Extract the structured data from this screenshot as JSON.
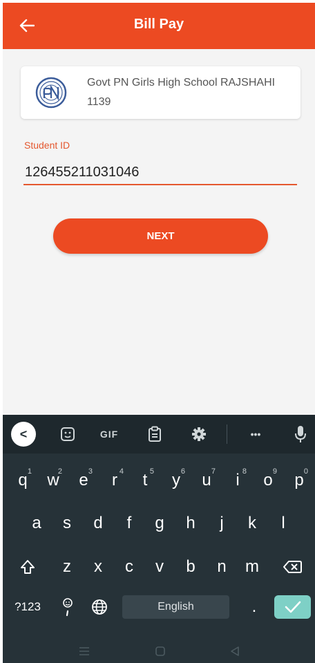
{
  "appbar": {
    "title": "Bill Pay",
    "back_icon": "arrow-left-icon"
  },
  "school": {
    "name": "Govt PN Girls High School RAJSHAHI",
    "code": "1139",
    "logo_icon": "school-logo-icon"
  },
  "form": {
    "label": "Student ID",
    "value": "126455211031046"
  },
  "next_label": "NEXT",
  "keyboard": {
    "toolbar": {
      "collapse": "<",
      "gif": "GIF",
      "more": "•••"
    },
    "row1": [
      {
        "k": "q",
        "h": "1"
      },
      {
        "k": "w",
        "h": "2"
      },
      {
        "k": "e",
        "h": "3"
      },
      {
        "k": "r",
        "h": "4"
      },
      {
        "k": "t",
        "h": "5"
      },
      {
        "k": "y",
        "h": "6"
      },
      {
        "k": "u",
        "h": "7"
      },
      {
        "k": "i",
        "h": "8"
      },
      {
        "k": "o",
        "h": "9"
      },
      {
        "k": "p",
        "h": "0"
      }
    ],
    "row2": [
      "a",
      "s",
      "d",
      "f",
      "g",
      "h",
      "j",
      "k",
      "l"
    ],
    "row3": [
      "z",
      "x",
      "c",
      "v",
      "b",
      "n",
      "m"
    ],
    "sym_label": "?123",
    "space_label": "English",
    "period": "."
  },
  "colors": {
    "primary": "#ec4a22",
    "keyboard_bg": "#263238",
    "enter": "#7ed0c6"
  }
}
